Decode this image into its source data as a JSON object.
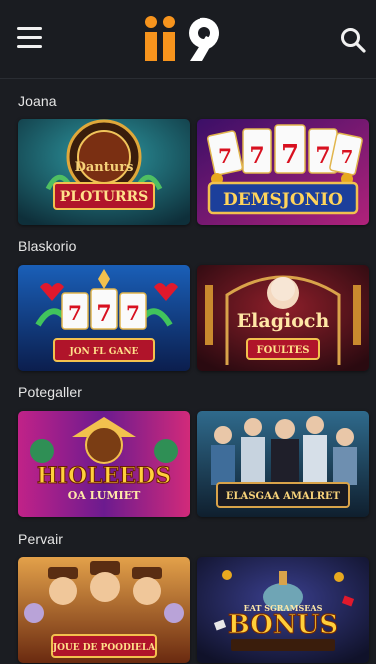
{
  "header": {
    "logo_text": "ii9"
  },
  "sections": [
    {
      "title": "Joana",
      "games": [
        {
          "banner": "PLOTURRS",
          "headline": "Danturs"
        },
        {
          "banner": "DEMSJONIO",
          "headline": ""
        }
      ]
    },
    {
      "title": "Blaskorio",
      "games": [
        {
          "banner": "JON FL GANE",
          "headline": ""
        },
        {
          "banner": "FOULTES",
          "headline": "Elagioch"
        }
      ]
    },
    {
      "title": "Potegaller",
      "games": [
        {
          "banner": "HIOLEEDS",
          "headline": "OA LUMIET"
        },
        {
          "banner": "ELASGAA AMALRET",
          "headline": ""
        }
      ]
    },
    {
      "title": "Pervair",
      "games": [
        {
          "banner": "JOUE DE POODIELA",
          "headline": ""
        },
        {
          "banner": "BONUS",
          "headline": "EAT SGRAMSEAS"
        }
      ]
    }
  ],
  "colors": {
    "background": "#1b1d22",
    "logo_orange": "#f7941d",
    "accent_gold": "#f2c14e"
  }
}
